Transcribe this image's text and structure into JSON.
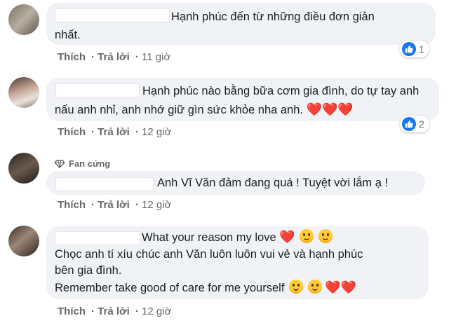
{
  "actions": {
    "like": "Thích",
    "reply": "Trả lời"
  },
  "comments": [
    {
      "lines": [
        "Hạnh phúc đến từ những điều đơn giản",
        "nhất."
      ],
      "time": "11 giờ",
      "reaction_count": "1"
    },
    {
      "lines": [
        "Hạnh phúc nào bằng bữa cơm gia đình, do tự tay anh",
        "nấu anh nhỉ, anh nhớ giữ gìn sức khỏe nha anh."
      ],
      "time": "12 giờ",
      "reaction_count": "2"
    },
    {
      "badge": "Fan cứng",
      "lines": [
        "Anh Vĩ Văn đảm đang quá ! Tuyệt vời lắm ạ !"
      ],
      "time": "12 giờ"
    },
    {
      "lines": [
        "What your reason my love",
        "Chọc anh tí xíu chúc anh Văn luôn luôn vui vẻ và hạnh phúc",
        "bên gia đình.",
        "Remember take good of care for me yourself"
      ],
      "time": "12 giờ"
    }
  ],
  "colors": {
    "like_blue": "#1877f2",
    "bubble_bg": "#f0f2f5",
    "meta_gray": "#65676b",
    "heart": "#e0245e"
  },
  "icons": {
    "reaction": "thumbs-up-icon",
    "badge": "diamond-icon",
    "heart": "heart-emoji",
    "kiss": "kiss-emoji",
    "laugh": "laugh-emoji"
  }
}
